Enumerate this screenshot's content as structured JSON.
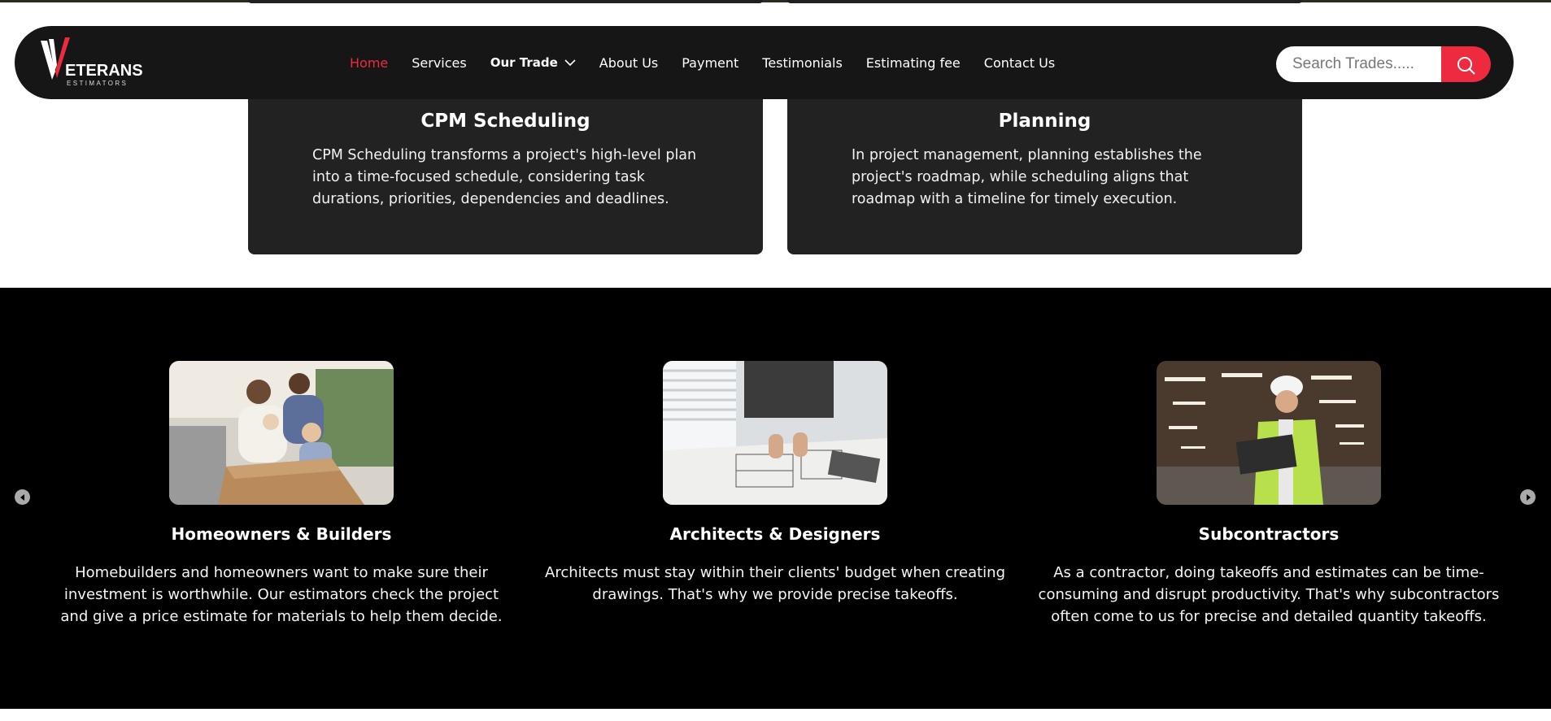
{
  "navbar": {
    "logo_text": "ETERANS",
    "logo_sub": "ESTIMATORS",
    "links": [
      {
        "label": "Home",
        "active": true
      },
      {
        "label": "Services"
      },
      {
        "label": "Our Trade"
      },
      {
        "label": "About Us"
      },
      {
        "label": "Payment"
      },
      {
        "label": "Testimonials"
      },
      {
        "label": "Estimating fee"
      },
      {
        "label": "Contact Us"
      }
    ],
    "search_placeholder": "Search Trades....."
  },
  "features": [
    {
      "title": "CPM Scheduling",
      "text": "CPM Scheduling transforms a project's high-level plan into a time-focused schedule, considering task durations, priorities, dependencies and deadlines."
    },
    {
      "title": "Planning",
      "text": "In project management, planning establishes the project's roadmap, while scheduling aligns that roadmap with a timeline for timely execution."
    }
  ],
  "audiences": [
    {
      "title": "Homeowners & Builders",
      "text": "Homebuilders and homeowners want to make sure their investment is worthwhile. Our estimators check the project and give a price estimate for materials to help them decide.",
      "image": "family-unpacking-photo"
    },
    {
      "title": "Architects & Designers",
      "text": "Architects must stay within their clients' budget when creating drawings. That's why we provide precise takeoffs.",
      "image": "blueprint-review-photo"
    },
    {
      "title": "Subcontractors",
      "text": "As a contractor, doing takeoffs and estimates can be time-consuming and disrupt productivity. That's why subcontractors often come to us for precise and detailed quantity takeoffs.",
      "image": "worker-laptop-warehouse-photo"
    }
  ],
  "colors": {
    "accent": "#ee2a3e",
    "nav_bg": "#161616",
    "card_bg": "#222222",
    "band_bg": "#000000"
  },
  "icons": {
    "search": "search-icon",
    "prev": "chevron-left-icon",
    "next": "chevron-right-icon",
    "dropdown": "chevron-down-icon"
  }
}
